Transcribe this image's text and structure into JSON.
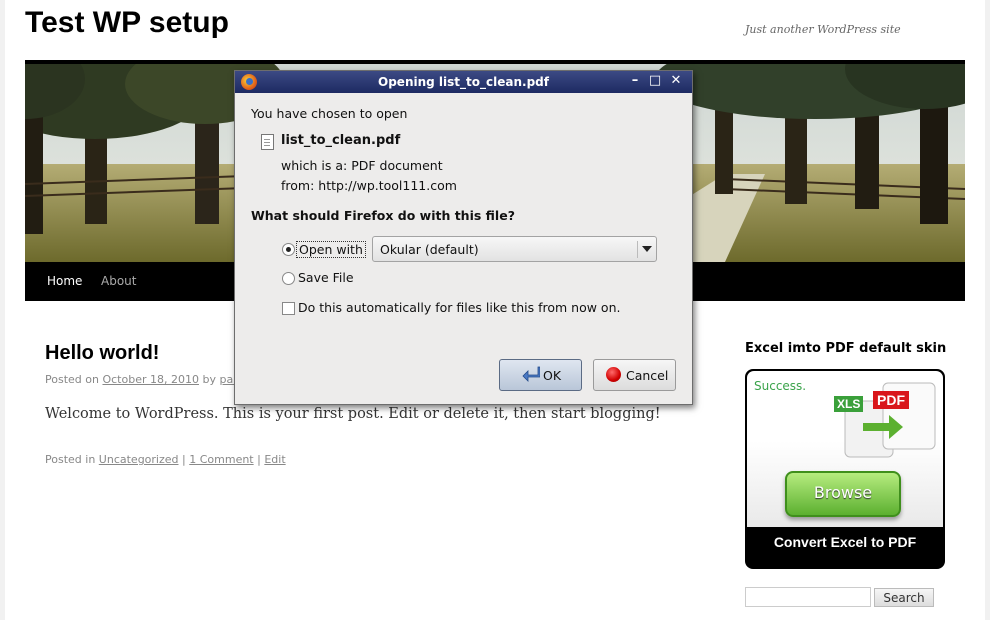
{
  "site": {
    "title": "Test WP setup",
    "tagline": "Just another WordPress site"
  },
  "menu": {
    "items": [
      {
        "label": "Home"
      },
      {
        "label": "About"
      }
    ]
  },
  "post": {
    "title": "Hello world!",
    "posted_on_prefix": "Posted on",
    "date": "October 18, 2010",
    "by": "by",
    "author": "pai",
    "body": "Welcome to WordPress. This is your first post. Edit or delete it, then start blogging!",
    "posted_in_prefix": "Posted in",
    "category": "Uncategorized",
    "sep": "|",
    "comments": "1 Comment",
    "edit": "Edit"
  },
  "sidebar": {
    "widget_title": "Excel imto PDF default skin",
    "ad": {
      "success": "Success.",
      "xls": "XLS",
      "pdf": "PDF",
      "browse": "Browse",
      "footer": "Convert Excel to PDF"
    },
    "search_button": "Search"
  },
  "dialog": {
    "title": "Opening list_to_clean.pdf",
    "chosen_text": "You have chosen to open",
    "filename": "list_to_clean.pdf",
    "which_is_label": "which is a:",
    "which_is_value": "PDF document",
    "from_label": "from:",
    "from_value": "http://wp.tool111.com",
    "question": "What should Firefox do with this file?",
    "open_with_label": "Open with",
    "open_with_app": "Okular (default)",
    "save_file_label": "Save File",
    "auto_label": "Do this automatically for files like this from now on.",
    "ok_label": "OK",
    "cancel_label": "Cancel",
    "selected_option": "open_with",
    "auto_checked": false
  },
  "colors": {
    "dialog_titlebar": "#2b3873",
    "menu_bg": "#000000",
    "ad_green": "#5cb030",
    "pdf_red": "#d9161b"
  }
}
